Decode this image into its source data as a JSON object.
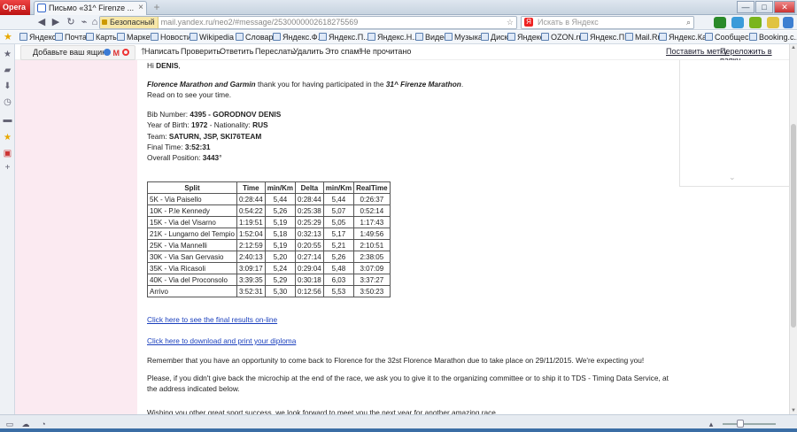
{
  "browser": {
    "opera_label": "Opera",
    "tab_title": "Письмо «31^ Firenze ...",
    "tab_close": "×",
    "new_tab": "+",
    "secure_label": "Безопасный",
    "url": "mail.yandex.ru/neo2/#message/2530000002618275569",
    "search_placeholder": "Искать в Яндекс",
    "search_engine_icon": "Я",
    "window_controls": [
      "—",
      "□",
      "✕"
    ]
  },
  "bookmarks": [
    "Яндекс",
    "Почта",
    "Карты",
    "Маркет",
    "Новости",
    "Wikipedia",
    "Словари",
    "Яндекс.Ф...",
    "Яндекс.П...",
    "Яндекс.Н...",
    "Видео",
    "Музыка",
    "Диск",
    "Яндекс",
    "OZON.ru",
    "Яндекс.П...",
    "Mail.Ru",
    "Яндекс.Ка...",
    "Сообщес...",
    "Booking.c..."
  ],
  "mail_toolbar": {
    "promo": "Добавьте ваш ящик",
    "actions": [
      "Написать",
      "Проверить",
      "Ответить",
      "Переслать",
      "Удалить",
      "Это спам!",
      "Не прочитано"
    ],
    "right_actions": [
      "Поставить метку",
      "Переложить в папку"
    ]
  },
  "message": {
    "greeting_prefix": "Hi ",
    "greeting_name": "DENIS",
    "greeting_suffix": ",",
    "thanks_bold1": "Florence Marathon and Garmin",
    "thanks_mid": " thank you for having participated in the ",
    "thanks_bold2": "31^ Firenze Marathon",
    "thanks_end": ".",
    "read_on": "Read on to see your time.",
    "bib_label": "Bib Number: ",
    "bib_value": "4395 - GORODNOV DENIS",
    "yob_label": "Year of Birth: ",
    "yob_value": "1972",
    "nat_label": " - Nationality: ",
    "nat_value": "RUS",
    "team_label": "Team: ",
    "team_value": "SATURN, JSP, SKI76TEAM",
    "final_label": "Final Time: ",
    "final_value": "3:52:31",
    "pos_label": "Overall Position: ",
    "pos_value": "3443",
    "pos_suffix": "°",
    "link_results": "Click here to see the final results on-line",
    "link_diploma": "Click here to download and print your diploma",
    "remember": "Remember that you have an opportunity to come back to Florence for the 32st Florence Marathon due to take place on 29/11/2015. We're expecting you!",
    "microchip_line1": "Please, if you didn't give back the microchip at the end of the race, we ask you to give it to the organizing committee or to ship it to TDS - Timing Data Service, at",
    "microchip_line2": "the address indicated below.",
    "wishing": "Wishing you other great sport success, we look forward to meet you the next year for another amazing race."
  },
  "splits": {
    "headers": [
      "Split",
      "Time",
      "min/Km",
      "Delta",
      "min/Km",
      "RealTime"
    ],
    "rows": [
      [
        "5K - Via Paisello",
        "0:28:44",
        "5,44",
        "0:28:44",
        "5,44",
        "0:26:37"
      ],
      [
        "10K - P.le Kennedy",
        "0:54:22",
        "5,26",
        "0:25:38",
        "5,07",
        "0:52:14"
      ],
      [
        "15K - Via del Visarno",
        "1:19:51",
        "5,19",
        "0:25:29",
        "5,05",
        "1:17:43"
      ],
      [
        "21K - Lungarno del Tempio",
        "1:52:04",
        "5,18",
        "0:32:13",
        "5,17",
        "1:49:56"
      ],
      [
        "25K - Via Mannelli",
        "2:12:59",
        "5,19",
        "0:20:55",
        "5,21",
        "2:10:51"
      ],
      [
        "30K - Via San Gervasio",
        "2:40:13",
        "5,20",
        "0:27:14",
        "5,26",
        "2:38:05"
      ],
      [
        "35K - Via Ricasoli",
        "3:09:17",
        "5,24",
        "0:29:04",
        "5,48",
        "3:07:09"
      ],
      [
        "40K - Via del Proconsolo",
        "3:39:35",
        "5,29",
        "0:30:18",
        "6,03",
        "3:37:27"
      ],
      [
        "Arrivo",
        "3:52:31",
        "5,30",
        "0:12:56",
        "5,53",
        "3:50:23"
      ]
    ]
  },
  "colors": {
    "pink_column": "#fbeaf1",
    "link": "#1a3fbd",
    "opera_red": "#cc1f1f"
  }
}
